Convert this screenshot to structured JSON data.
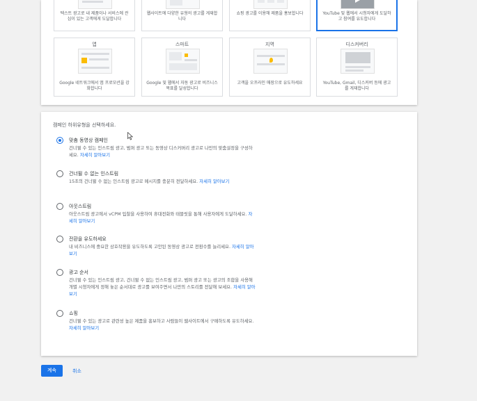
{
  "goal_cards_top": [
    {
      "desc": "텍스트 광고로 내 제품이나 서비스에 관심이 있는 고객에게 도달합니다"
    },
    {
      "desc": "웹사이트에 다양한 유형의 광고를 게재합니다"
    },
    {
      "desc": "쇼핑 광고를 이용해 제품을 홍보합니다"
    },
    {
      "desc": "YouTube 및 웹에서 시청자에게 도달하고 참여를 유도합니다",
      "selected": true
    }
  ],
  "goal_cards_bottom": [
    {
      "name": "앱",
      "desc": "Google 네트워크에서 앱 프로모션을 강화합니다"
    },
    {
      "name": "스마트",
      "desc": "Google 및 웹에서 자동 광고로 비즈니스 목표를 달성합니다"
    },
    {
      "name": "지역",
      "desc": "고객을 오프라인 매장으로 유도하세요"
    },
    {
      "name": "디스커버리",
      "desc": "YouTube, Gmail, 디스커버 등에 광고를 게재합니다"
    }
  ],
  "subtype": {
    "title": "캠페인 하위유형을 선택하세요.",
    "learn_more": "자세히 알아보기",
    "options": [
      {
        "title": "맞춤 동영상 캠페인",
        "desc": "건너뛸 수 있는 인스트림 광고, 범퍼 광고 또는 동영상 디스커버리 광고로 나만의 맞춤설정을 구성하세요.",
        "checked": true
      },
      {
        "title": "건너뛸 수 없는 인스트림",
        "desc": "15초의 건너뛸 수 없는 인스트림 광고로 메시지를 충분히 전달하세요.",
        "checked": false
      },
      {
        "title": "아웃스트림",
        "desc": "아웃스트림 광고에서 vCPM 입찰을 사용하여 휴대전화와 태블릿을 통해 사용자에게 도달하세요.",
        "checked": false
      },
      {
        "title": "전환을 유도하세요",
        "desc": "내 비즈니스에 중요한 상호작용을 유도하도록 고안된 동영상 광고로 전환수를 늘리세요.",
        "checked": false
      },
      {
        "title": "광고 순서",
        "desc": "건너뛸 수 있는 인스트림 광고, 건너뛸 수 없는 인스트림 광고, 범퍼 광고 또는 광고의 조합을 사용해 개별 시청자에게 정해 놓은 순서대로 광고를 보여주면서 나만의 스토리를 전달해 보세요.",
        "checked": false
      },
      {
        "title": "쇼핑",
        "desc": "건너뛸 수 있는 광고로 관련성 높은 제품을 홍보하고 사람들이 웹사이트에서 구매하도록 유도하세요.",
        "checked": false
      }
    ]
  },
  "actions": {
    "continue": "계속",
    "cancel": "취소"
  },
  "colors": {
    "accent": "#1a73e8",
    "background": "#f1f1f1"
  }
}
